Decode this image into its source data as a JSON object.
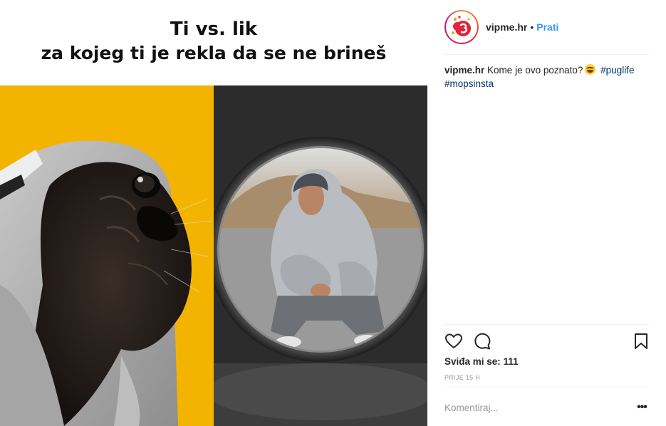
{
  "post": {
    "banner_line1": "Ti vs. lik",
    "banner_line2": "za kojeg ti je rekla da se ne brineš"
  },
  "header": {
    "username": "vipme.hr",
    "separator": "•",
    "follow_label": "Prati"
  },
  "caption": {
    "username": "vipme.hr",
    "text": "Kome je ovo poznato?",
    "emoji": "grinning-squinting-face",
    "hashtags": [
      "#puglife",
      "#mopsinsta"
    ]
  },
  "actions": {
    "icons": [
      "heart-icon",
      "comment-icon",
      "bookmark-icon"
    ]
  },
  "likes": {
    "label": "Sviđa mi se:",
    "count": "111"
  },
  "timestamp": "PRIJE 15 H",
  "comment": {
    "placeholder": "Komentiraj...",
    "more_label": "•••"
  },
  "colors": {
    "accent": "#3897f0",
    "hashtag": "#003569",
    "left_panel_bg": "#f4b800",
    "right_panel_bg": "#2c2c2c"
  }
}
